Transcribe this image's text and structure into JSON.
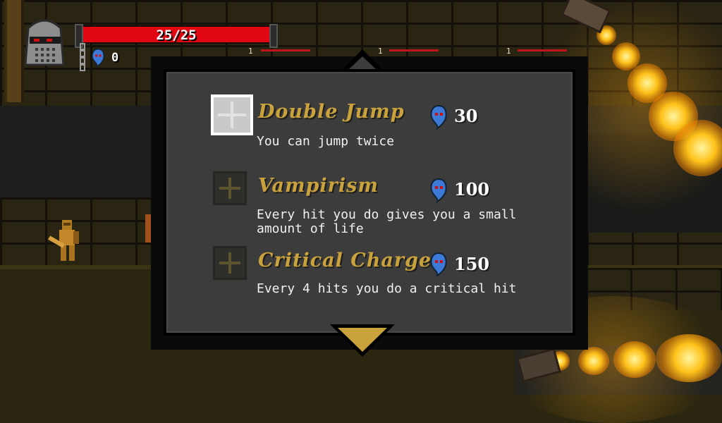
{
  "hud": {
    "health_text": "25/25",
    "souls": "0",
    "enemy_markers": [
      "1",
      "1",
      "1"
    ]
  },
  "shop": {
    "items": [
      {
        "title": "Double Jump",
        "description": "You can jump twice",
        "cost": "30",
        "selected": true
      },
      {
        "title": "Vampirism",
        "description": "Every hit you do gives you a small amount of life",
        "cost": "100",
        "selected": false
      },
      {
        "title": "Critical Charge",
        "description": "Every 4 hits you do a critical hit",
        "cost": "150",
        "selected": false
      }
    ]
  },
  "colors": {
    "health_bar": "#e00612",
    "title_gold": "#c9a23c",
    "panel_bg": "#3c3c3c",
    "soul_blue": "#3d7ad8"
  },
  "icons": {
    "soul": "blue-ghost-soul-icon",
    "helmet": "knight-helmet-icon",
    "scroll_up": "triangle-up-icon",
    "scroll_down": "triangle-down-icon"
  }
}
